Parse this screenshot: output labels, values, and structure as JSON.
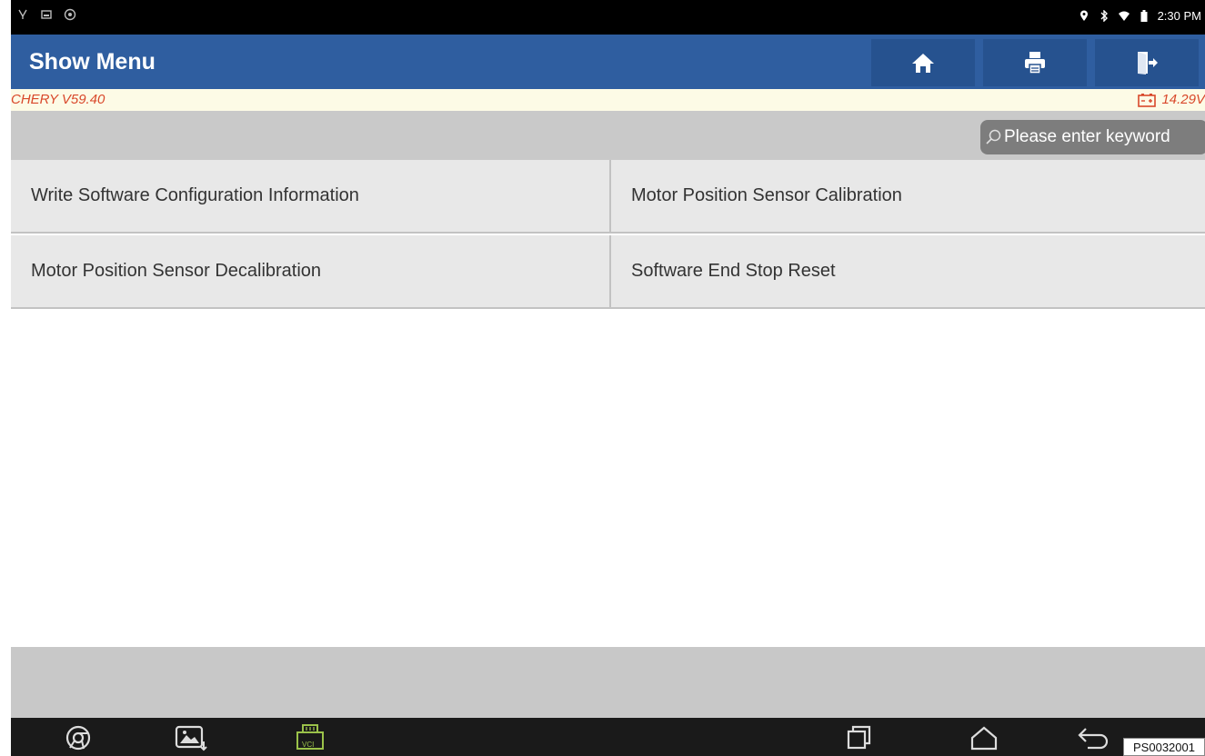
{
  "status_bar": {
    "time": "2:30 PM",
    "left_icons": [
      "usb-debug-icon",
      "image-icon",
      "settings-icon"
    ],
    "right_icons": [
      "location-icon",
      "bluetooth-icon",
      "wifi-icon",
      "battery-icon"
    ]
  },
  "header": {
    "title": "Show Menu",
    "buttons": [
      "home-icon",
      "print-icon",
      "exit-icon"
    ],
    "bg_color": "#2f5ea0"
  },
  "info_bar": {
    "brand_version": "CHERY V59.40",
    "voltage": "14.29V",
    "text_color": "#d9482b"
  },
  "search": {
    "placeholder": "Please enter keyword"
  },
  "menu": {
    "items": [
      "Write Software Configuration Information",
      "Motor Position Sensor Calibration",
      "Motor Position Sensor Decalibration",
      "Software End Stop Reset"
    ]
  },
  "navbar": {
    "icons": [
      "chrome-icon",
      "gallery-icon",
      "vci-icon",
      "recent-apps-icon",
      "home-nav-icon",
      "back-icon"
    ],
    "vci_label": "VCI"
  },
  "figure_code": "PS0032001"
}
